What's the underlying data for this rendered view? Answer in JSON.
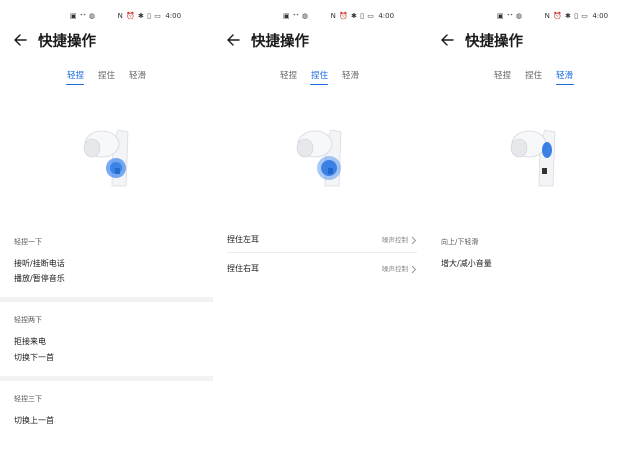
{
  "status_bar": {
    "time": "4:00",
    "left_icons": "▣ ᐩᐩ ◍",
    "right_icons": "N ⏰ ✱ ▯ ▭"
  },
  "header": {
    "title": "快捷操作"
  },
  "tabs": [
    "轻捏",
    "捏住",
    "轻滑"
  ],
  "screens": {
    "pinch": {
      "sections": [
        {
          "heading": "轻捏一下",
          "items": [
            "接听/挂断电话",
            "播放/暂停音乐"
          ]
        },
        {
          "heading": "轻捏两下",
          "items": [
            "拒接来电",
            "切换下一首"
          ]
        },
        {
          "heading": "轻捏三下",
          "items": [
            "切换上一首"
          ]
        }
      ]
    },
    "hold": {
      "rows": [
        {
          "label": "捏住左耳",
          "value": "噪声控制"
        },
        {
          "label": "捏住右耳",
          "value": "噪声控制"
        }
      ]
    },
    "swipe": {
      "heading": "向上/下轻滑",
      "item": "增大/减小音量"
    }
  },
  "colors": {
    "accent": "#1a6be0",
    "highlight": "#3d86f0",
    "divider": "#f2f2f2"
  }
}
